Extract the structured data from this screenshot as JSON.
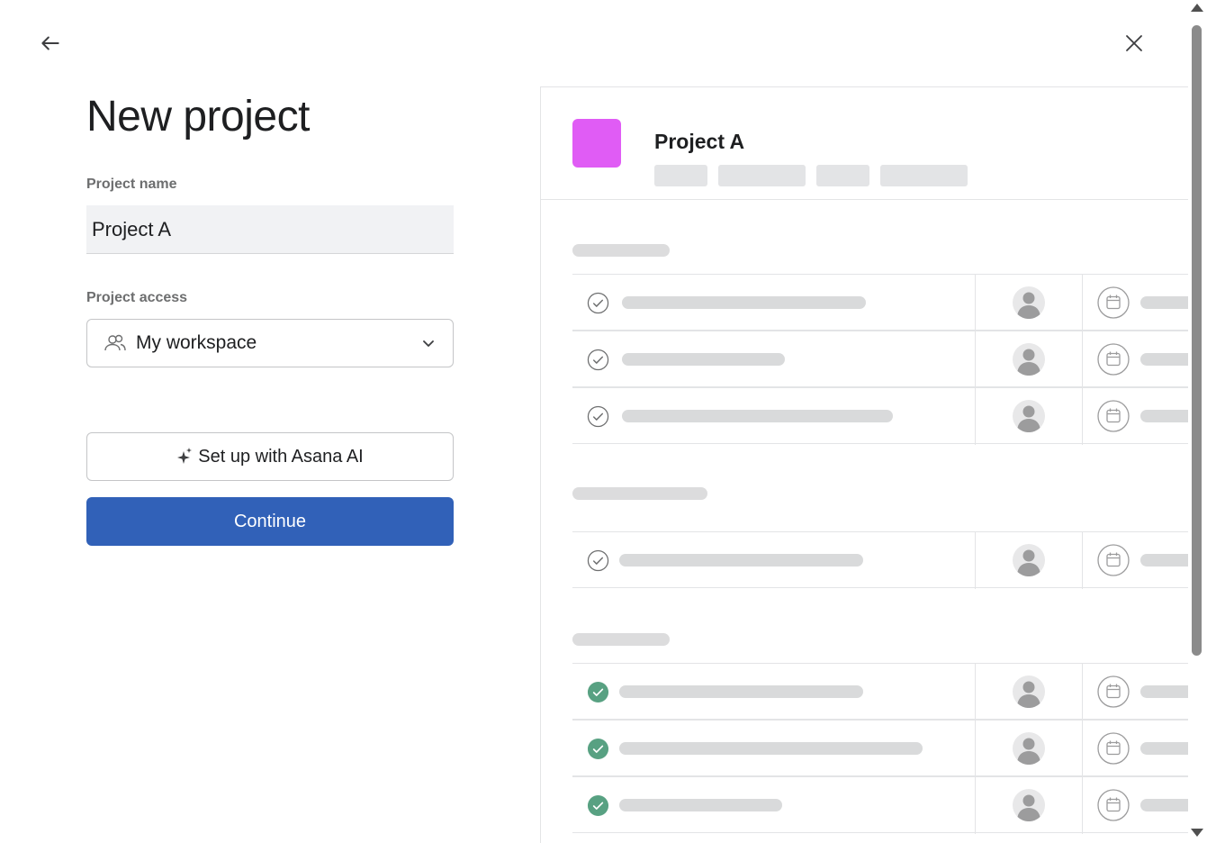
{
  "header": {
    "back_icon": "arrow-left-icon",
    "close_icon": "close-icon"
  },
  "form": {
    "title": "New project",
    "name_label": "Project name",
    "name_value": "Project A",
    "access_label": "Project access",
    "access_icon": "people-icon",
    "access_value": "My workspace",
    "ai_icon": "sparkle-icon",
    "ai_button": "Set up with Asana AI",
    "continue_button": "Continue"
  },
  "preview": {
    "title": "Project A",
    "tile_color": "#e05cf5",
    "sections": [
      {
        "tasks": [
          {
            "completed": false
          },
          {
            "completed": false
          },
          {
            "completed": false
          }
        ]
      },
      {
        "tasks": [
          {
            "completed": false
          }
        ]
      },
      {
        "tasks": [
          {
            "completed": true
          },
          {
            "completed": true
          },
          {
            "completed": true
          }
        ]
      }
    ]
  },
  "colors": {
    "primary": "#3161b8",
    "complete": "#58a182",
    "tile": "#e05cf5"
  }
}
